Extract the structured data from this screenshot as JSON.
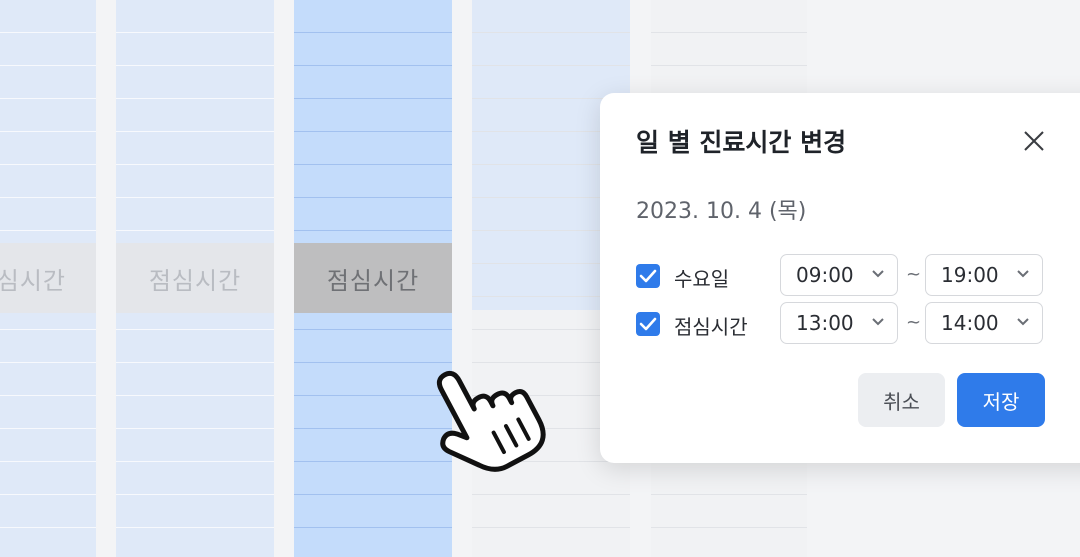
{
  "schedule": {
    "lunch_label_cut": "심시간",
    "lunch_label": "점심시간"
  },
  "dialog": {
    "title": "일 별 진료시간 변경",
    "date": "2023. 10. 4 (목)",
    "rows": [
      {
        "label": "수요일",
        "checked": true,
        "start": "09:00",
        "end": "19:00"
      },
      {
        "label": "점심시간",
        "checked": true,
        "start": "13:00",
        "end": "14:00"
      }
    ],
    "range_separator": "~",
    "cancel_label": "취소",
    "save_label": "저장"
  },
  "colors": {
    "accent": "#2f7bea",
    "selected_column": "#c4dcfb",
    "column": "#dfe9f8"
  }
}
